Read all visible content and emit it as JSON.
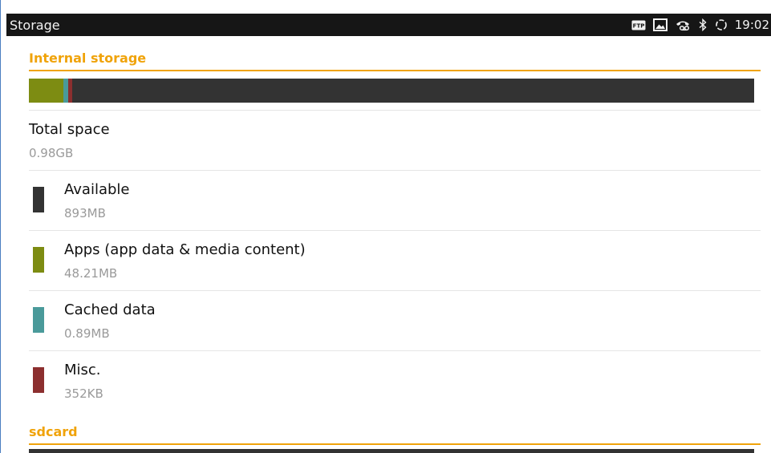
{
  "status_bar": {
    "title": "Storage",
    "time": "19:02",
    "icons": [
      "ftp-icon",
      "image-icon",
      "voicemail-icon",
      "bluetooth-icon",
      "sync-icon"
    ]
  },
  "internal_storage": {
    "header": "Internal storage",
    "usage_fractions": {
      "apps": 0.048,
      "cached": 0.006,
      "misc": 0.006
    },
    "colors": {
      "available": "#333333",
      "apps": "#7d8c12",
      "cached": "#4a9a9a",
      "misc": "#8c2f2f",
      "accent": "#f0a30a"
    },
    "total": {
      "label": "Total space",
      "value": "0.98GB"
    },
    "items": [
      {
        "label": "Available",
        "value": "893MB"
      },
      {
        "label": "Apps (app data & media content)",
        "value": "48.21MB"
      },
      {
        "label": "Cached data",
        "value": "0.89MB"
      },
      {
        "label": "Misc.",
        "value": "352KB"
      }
    ]
  },
  "sdcard": {
    "header": "sdcard"
  }
}
